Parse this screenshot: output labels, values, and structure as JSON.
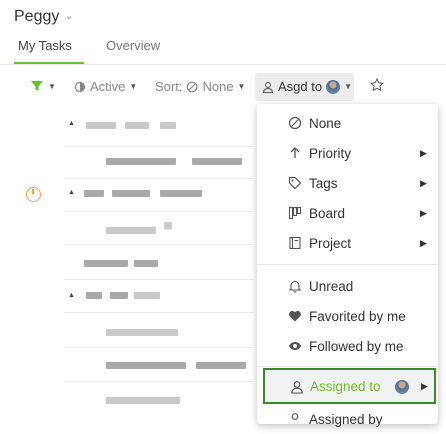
{
  "header": {
    "user_name": "Peggy"
  },
  "tabs": [
    {
      "label": "My Tasks"
    },
    {
      "label": "Overview"
    }
  ],
  "toolbar": {
    "active_label": "Active",
    "sort_label": "Sort:",
    "sort_value": "None",
    "assigned_label": "Asgd to"
  },
  "menu": {
    "none": "None",
    "priority": "Priority",
    "tags": "Tags",
    "board": "Board",
    "project": "Project",
    "unread": "Unread",
    "favorited": "Favorited by me",
    "followed": "Followed by me",
    "assigned_to": "Assigned to",
    "assigned_by": "Assigned by"
  },
  "colors": {
    "accent_green": "#6bbf2a",
    "highlight_border": "#3a8a2a",
    "timer_orange": "#f0a050"
  }
}
